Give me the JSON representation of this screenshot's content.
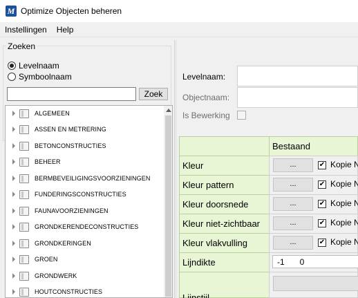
{
  "window": {
    "title": "Optimize Objecten beheren",
    "icon": "app-logo-icon",
    "icon_glyph": "M"
  },
  "menu": [
    {
      "label": "Instellingen"
    },
    {
      "label": "Help"
    }
  ],
  "search": {
    "group_title": "Zoeken",
    "options": [
      {
        "label": "Levelnaam",
        "checked": true
      },
      {
        "label": "Symboolnaam",
        "checked": false
      }
    ],
    "input_value": "",
    "button_label": "Zoek"
  },
  "tree": {
    "items": [
      {
        "label": "ALGEMEEN"
      },
      {
        "label": "ASSEN EN METRERING"
      },
      {
        "label": "BETONCONSTRUCTIES"
      },
      {
        "label": "BEHEER"
      },
      {
        "label": "BERMBEVEILIGINGSVOORZIENINGEN"
      },
      {
        "label": "FUNDERINGSCONSTRUCTIES"
      },
      {
        "label": "FAUNAVOORZIENINGEN"
      },
      {
        "label": "GRONDKERENDECONSTRUCTIES"
      },
      {
        "label": "GRONDKERINGEN"
      },
      {
        "label": "GROEN"
      },
      {
        "label": "GRONDWERK"
      },
      {
        "label": "HOUTCONSTRUCTIES"
      }
    ]
  },
  "details": {
    "levelnaam_label": "Levelnaam:",
    "levelnaam_value": "",
    "objectnaam_label": "Objectnaam:",
    "objectnaam_value": "",
    "bewerking_label": "Is Bewerking",
    "bewerking_checked": false
  },
  "grid": {
    "column_header": "Bestaand",
    "button_label": "...",
    "rows": [
      {
        "label": "Kleur",
        "kopie_label": "Kopie N",
        "checked": true
      },
      {
        "label": "Kleur pattern",
        "kopie_label": "Kopie N",
        "checked": true
      },
      {
        "label": "Kleur doorsnede",
        "kopie_label": "Kopie N",
        "checked": true
      },
      {
        "label": "Kleur niet-zichtbaar",
        "kopie_label": "Kopie N",
        "checked": true
      },
      {
        "label": "Kleur vlakvulling",
        "kopie_label": "Kopie N",
        "checked": true
      }
    ],
    "lijndikte": {
      "label": "Lijndikte",
      "value_a": "-1",
      "value_b": "0"
    },
    "lijnstijl": {
      "label": "Lijnstijl"
    }
  },
  "colors": {
    "grid_header_bg": "#e8f6d6",
    "accent": "#1f4e9a"
  }
}
